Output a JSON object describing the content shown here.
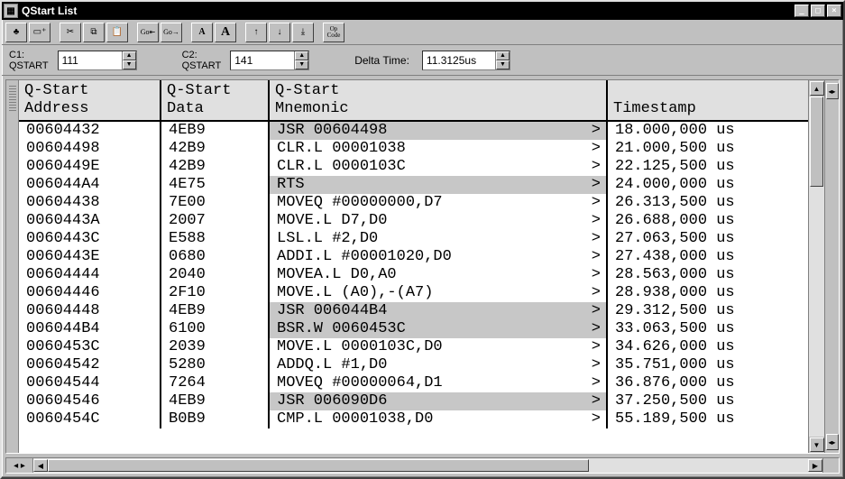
{
  "window": {
    "title": "QStart List"
  },
  "toolbar": {
    "buttons": [
      "tree",
      "new",
      "cut",
      "copy",
      "paste",
      "goto-start",
      "goto",
      "font-small",
      "font-large",
      "up",
      "down",
      "down-stop",
      "opcode"
    ]
  },
  "params": {
    "c1_label": "C1:",
    "c1_sub": "QSTART",
    "c1_value": "111",
    "c2_label": "C2:",
    "c2_sub": "QSTART",
    "c2_value": "141",
    "delta_label": "Delta Time:",
    "delta_value": "11.3125us"
  },
  "columns": {
    "addr": "Q-Start\nAddress",
    "data": "Q-Start\nData",
    "mnem": "Q-Start\nMnemonic",
    "ts": "\nTimestamp"
  },
  "rows": [
    {
      "addr": "00604432",
      "data": "4EB9",
      "mnem": "JSR 00604498",
      "hl": true,
      "ts": "18.000,000 us"
    },
    {
      "addr": "00604498",
      "data": "42B9",
      "mnem": "CLR.L 00001038",
      "hl": false,
      "ts": "21.000,500 us"
    },
    {
      "addr": "0060449E",
      "data": "42B9",
      "mnem": "CLR.L 0000103C",
      "hl": false,
      "ts": "22.125,500 us"
    },
    {
      "addr": "006044A4",
      "data": "4E75",
      "mnem": "RTS",
      "hl": true,
      "ts": "24.000,000 us"
    },
    {
      "addr": "00604438",
      "data": "7E00",
      "mnem": "MOVEQ #00000000,D7",
      "hl": false,
      "ts": "26.313,500 us"
    },
    {
      "addr": "0060443A",
      "data": "2007",
      "mnem": "MOVE.L D7,D0",
      "hl": false,
      "ts": "26.688,000 us"
    },
    {
      "addr": "0060443C",
      "data": "E588",
      "mnem": "LSL.L #2,D0",
      "hl": false,
      "ts": "27.063,500 us"
    },
    {
      "addr": "0060443E",
      "data": "0680",
      "mnem": "ADDI.L #00001020,D0",
      "hl": false,
      "ts": "27.438,000 us"
    },
    {
      "addr": "00604444",
      "data": "2040",
      "mnem": "MOVEA.L D0,A0",
      "hl": false,
      "ts": "28.563,000 us"
    },
    {
      "addr": "00604446",
      "data": "2F10",
      "mnem": "MOVE.L (A0),-(A7)",
      "hl": false,
      "ts": "28.938,000 us"
    },
    {
      "addr": "00604448",
      "data": "4EB9",
      "mnem": "JSR 006044B4",
      "hl": true,
      "ts": "29.312,500 us"
    },
    {
      "addr": "006044B4",
      "data": "6100",
      "mnem": "BSR.W 0060453C",
      "hl": true,
      "ts": "33.063,500 us"
    },
    {
      "addr": "0060453C",
      "data": "2039",
      "mnem": "MOVE.L 0000103C,D0",
      "hl": false,
      "ts": "34.626,000 us"
    },
    {
      "addr": "00604542",
      "data": "5280",
      "mnem": "ADDQ.L #1,D0",
      "hl": false,
      "ts": "35.751,000 us"
    },
    {
      "addr": "00604544",
      "data": "7264",
      "mnem": "MOVEQ #00000064,D1",
      "hl": false,
      "ts": "36.876,000 us"
    },
    {
      "addr": "00604546",
      "data": "4EB9",
      "mnem": "JSR 006090D6",
      "hl": true,
      "ts": "37.250,500 us"
    },
    {
      "addr": "0060454C",
      "data": "B0B9",
      "mnem": "CMP.L 00001038,D0",
      "hl": false,
      "ts": "55.189,500 us"
    }
  ]
}
